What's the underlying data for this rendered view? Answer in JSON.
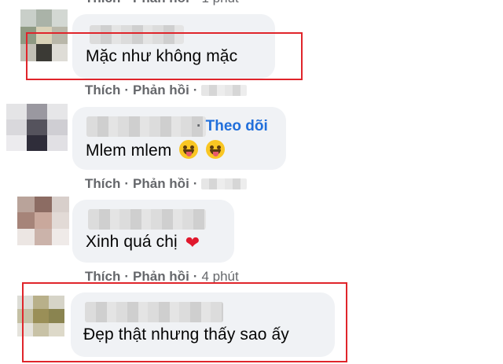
{
  "top_partial": {
    "like": "Thích",
    "reply": "Phản hồi",
    "time": "1 phút"
  },
  "actions_labels": {
    "like": "Thích",
    "reply": "Phản hồi",
    "separator": "·"
  },
  "comments": [
    {
      "text": "Mặc như không mặc",
      "highlighted": true
    },
    {
      "text": "Mlem mlem",
      "follow_label": "Theo dõi",
      "emojis": [
        "tongue-emoji",
        "tongue-emoji"
      ]
    },
    {
      "text": "Xinh quá chị",
      "emojis": [
        "heart-emoji"
      ],
      "time": "4 phút"
    },
    {
      "text": "Đẹp thật nhưng thấy sao ấy",
      "highlighted": true
    }
  ],
  "colors": {
    "bubble": "#f0f2f5",
    "meta": "#65676b",
    "link": "#216fdb",
    "highlight": "#e0252b"
  }
}
